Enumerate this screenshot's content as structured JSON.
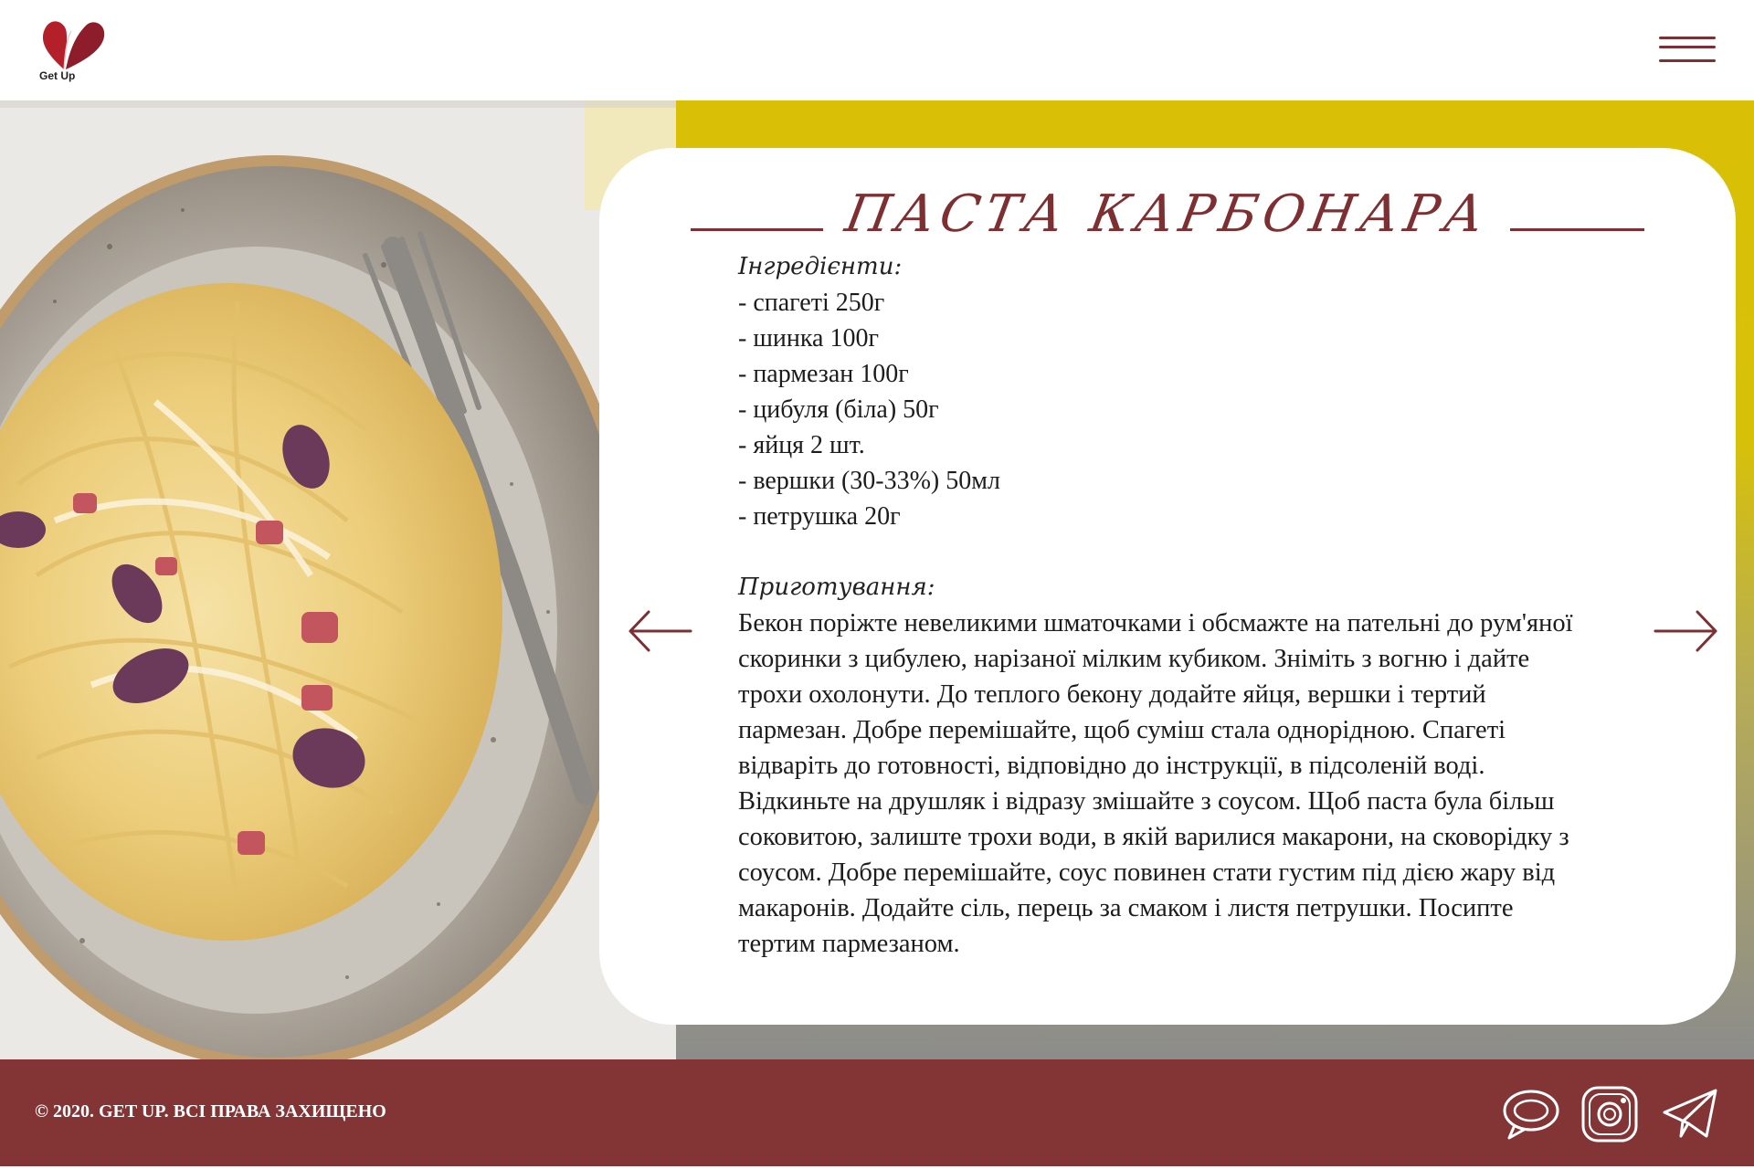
{
  "header": {
    "logo_text": "Get Up",
    "menu_icon": "hamburger-menu-icon"
  },
  "recipe": {
    "title": "ПАСТА КАРБОНАРА",
    "ingredients_label": "Інгредієнти:",
    "ingredients": [
      "- спагеті 250г",
      "- шинка 100г",
      "- пармезан 100г",
      "- цибуля (біла) 50г",
      "- яйця 2 шт.",
      "- вершки (30-33%) 50мл",
      "- петрушка 20г"
    ],
    "method_label": "Приготування:",
    "method_text": "Бекон поріжте невеликими шматочками і обсмажте на пательні до рум'яної скоринки з цибулею, нарізаної мілким кубиком. Зніміть з вогню і дайте трохи охолонути. До теплого бекону додайте яйця, вершки і тертий пармезан. Добре перемішайте, щоб суміш стала однорідною. Спагеті відваріть до готовності, відповідно до інструкції, в підсоленій воді. Відкиньте на друшляк і відразу змішайте з соусом. Щоб паста була більш соковитою, залиште трохи води, в якій варилися макарони, на сковорідку з соусом. Добре перемішайте, соус повинен стати густим під дією жару від макаронів. Додайте сіль, перець за смаком і листя петрушки. Посипте тертим пармезаном."
  },
  "navigation": {
    "prev_icon": "arrow-left-icon",
    "next_icon": "arrow-right-icon"
  },
  "footer": {
    "copyright": "© 2020. GET UP. ВСІ ПРАВА ЗАХИЩЕНО",
    "social": [
      "chat-bubble-icon",
      "instagram-icon",
      "telegram-icon"
    ]
  },
  "colors": {
    "brand": "#833536",
    "accent_yellow": "#d9c007",
    "logo_red": "#b3202a"
  }
}
